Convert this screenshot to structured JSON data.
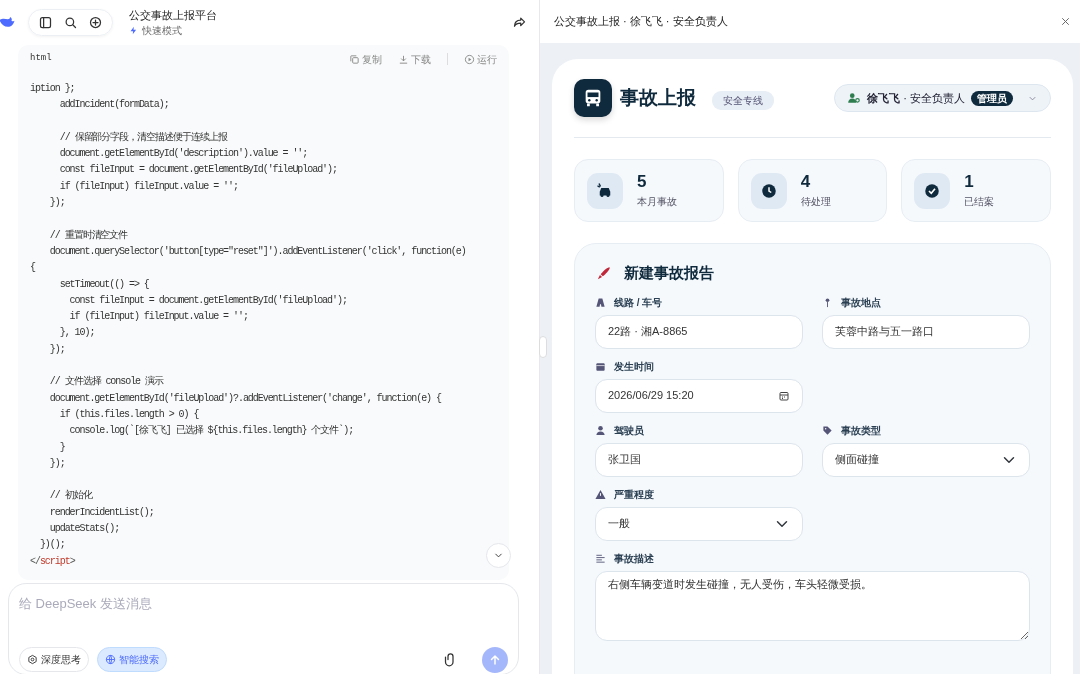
{
  "chat": {
    "title": "公交事故上报平台",
    "mode": "快速模式",
    "code_block": {
      "language": "html",
      "actions": [
        {
          "label": "复制",
          "kind": "copy"
        },
        {
          "label": "下载",
          "kind": "download"
        },
        {
          "label": "运行",
          "kind": "run"
        }
      ],
      "lines": [
        {
          "kind": "code",
          "text": "iption };"
        },
        {
          "kind": "code",
          "text": "      addIncident(formData);"
        },
        {
          "kind": "blank"
        },
        {
          "kind": "code",
          "text": "      // 保留部分字段，清空描述便于连续上报"
        },
        {
          "kind": "code",
          "text": "      document.getElementById('description').value = '';"
        },
        {
          "kind": "code",
          "text": "      const fileInput = document.getElementById('fileUpload');"
        },
        {
          "kind": "code",
          "text": "      if (fileInput) fileInput.value = '';"
        },
        {
          "kind": "code",
          "text": "    });"
        },
        {
          "kind": "blank"
        },
        {
          "kind": "code",
          "text": "    // 重置时清空文件"
        },
        {
          "kind": "code",
          "text": "    document.querySelector('button[type=\"reset\"]').addEventListener('click', function(e)"
        },
        {
          "kind": "code",
          "text": "{"
        },
        {
          "kind": "code",
          "text": "      setTimeout(() => {"
        },
        {
          "kind": "code",
          "text": "        const fileInput = document.getElementById('fileUpload');"
        },
        {
          "kind": "code",
          "text": "        if (fileInput) fileInput.value = '';"
        },
        {
          "kind": "code",
          "text": "      }, 10);"
        },
        {
          "kind": "code",
          "text": "    });"
        },
        {
          "kind": "blank"
        },
        {
          "kind": "code",
          "text": "    // 文件选择 console 演示"
        },
        {
          "kind": "code",
          "text": "    document.getElementById('fileUpload')?.addEventListener('change', function(e) {"
        },
        {
          "kind": "code",
          "text": "      if (this.files.length > 0) {"
        },
        {
          "kind": "code",
          "text": "        console.log(`[徐飞飞] 已选择 ${this.files.length} 个文件`);"
        },
        {
          "kind": "code",
          "text": "      }"
        },
        {
          "kind": "code",
          "text": "    });"
        },
        {
          "kind": "blank"
        },
        {
          "kind": "code",
          "text": "    // 初始化"
        },
        {
          "kind": "code",
          "text": "    renderIncidentList();"
        },
        {
          "kind": "code",
          "text": "    updateStats();"
        },
        {
          "kind": "code",
          "text": "  })();"
        },
        {
          "kind": "tag",
          "open": "</",
          "name": "script",
          "close": ">"
        }
      ]
    },
    "composer": {
      "placeholder": "给 DeepSeek 发送消息",
      "toggles": [
        {
          "label": "深度思考",
          "kind": "think",
          "selected": false
        },
        {
          "label": "智能搜索",
          "kind": "search",
          "selected": true
        }
      ],
      "send_disabled": true
    }
  },
  "preview": {
    "title": "公交事故上报 · 徐飞飞 · 安全负责人",
    "app": {
      "title": "事故上报",
      "tag": "安全专线",
      "user": "**徐飞飞** · 安全负责人",
      "role": "管理员",
      "stats": [
        {
          "value": "5",
          "label": "本月事故"
        },
        {
          "value": "4",
          "label": "待处理"
        },
        {
          "value": "1",
          "label": "已结案"
        }
      ],
      "form": {
        "title": "新建事故报告",
        "rows": [
          [
            {
              "label": "线路 / 车号",
              "kind": "text",
              "value": "22路 · 湘A-8865"
            },
            {
              "label": "事故地点",
              "kind": "text",
              "value": "芙蓉中路与五一路口"
            }
          ],
          [
            {
              "label": "发生时间",
              "kind": "date",
              "value": "2026/06/29  15:20"
            }
          ],
          [
            {
              "label": "驾驶员",
              "kind": "text",
              "value": "张卫国"
            },
            {
              "label": "事故类型",
              "kind": "select",
              "value": "侧面碰撞"
            }
          ],
          [
            {
              "label": "严重程度",
              "kind": "select",
              "value": "一般"
            }
          ],
          [
            {
              "label": "事故描述",
              "kind": "textarea",
              "value": "右侧车辆变道时发生碰撞，无人受伤，车头轻微受损。"
            }
          ]
        ]
      }
    }
  }
}
